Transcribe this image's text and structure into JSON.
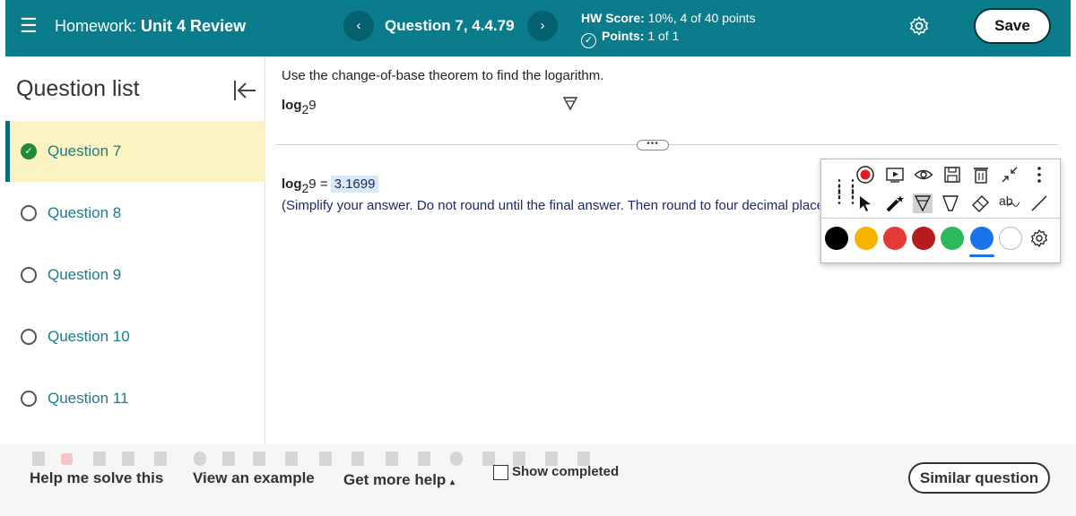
{
  "header": {
    "menu_icon": "hamburger-icon",
    "title_prefix": "Homework:",
    "title": "Unit 4 Review",
    "question_title": "Question 7, 4.4.79",
    "prev_label": "‹",
    "next_label": "›",
    "hw_score_label": "HW Score:",
    "hw_score_value": "10%, 4 of 40 points",
    "points_label": "Points:",
    "points_value": "1 of 1",
    "save_label": "Save",
    "accent_color": "#0b7c8c"
  },
  "sidebar": {
    "title": "Question list",
    "items": [
      {
        "label": "Question 7",
        "status": "completed"
      },
      {
        "label": "Question 8",
        "status": "open"
      },
      {
        "label": "Question 9",
        "status": "open"
      },
      {
        "label": "Question 10",
        "status": "open"
      },
      {
        "label": "Question 11",
        "status": "open"
      }
    ]
  },
  "question": {
    "instruction": "Use the change-of-base theorem to find the logarithm.",
    "expr_log": "log",
    "expr_base": "2",
    "expr_arg": "9",
    "answer_eq": "=",
    "answer_value": "3.1699",
    "hint": "(Simplify your answer. Do not round until the final answer. Then round to four decimal places as needed.)"
  },
  "annotation_toolbar": {
    "row1_icons": [
      "record-icon",
      "play-video-icon",
      "eye-icon",
      "save-disk-icon",
      "trash-icon",
      "collapse-arrows-icon",
      "more-vertical-icon"
    ],
    "row2_icons": [
      "pointer-icon",
      "magic-wand-icon",
      "highlighter-icon",
      "marker-icon",
      "eraser-icon",
      "text-tool-icon",
      "line-tool-icon"
    ],
    "text_tool_label": "ab",
    "colors": [
      "#000000",
      "#f5b400",
      "#e53935",
      "#b71c1c",
      "#2eb85c",
      "#1a73e8",
      "#ffffff"
    ],
    "selected_color": "#1a73e8"
  },
  "bottom": {
    "help_solve": "Help me solve this",
    "view_example": "View an example",
    "more_help": "Get more help",
    "more_help_caret": "▴",
    "show_completed": "Show completed",
    "similar_question": "Similar question"
  }
}
